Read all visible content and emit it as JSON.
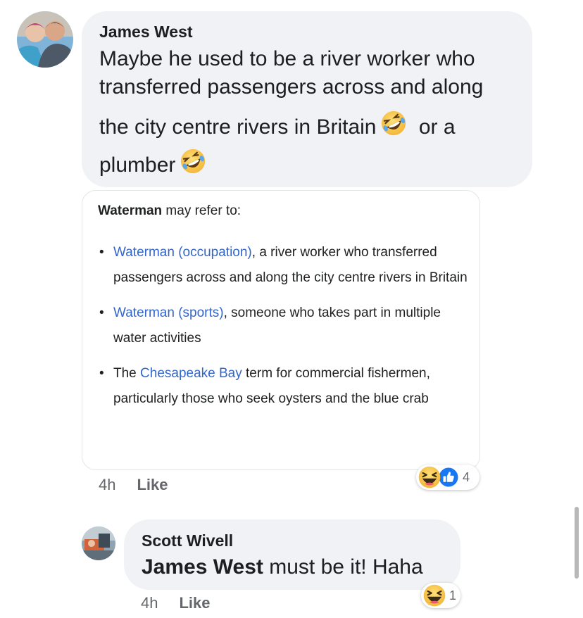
{
  "comment1": {
    "author": "James West",
    "text_line1": "Maybe he used to be a river worker who",
    "text_line2": "transferred passengers across and along",
    "text_line3": "the city centre rivers in Britain",
    "text_line3_tail": "or a",
    "text_line4": "plumber",
    "emoji": "rolling-on-floor-laughing-emoji",
    "time": "4h",
    "like_label": "Like",
    "reaction_count": "4",
    "reaction_icons": [
      "laughing-emoji",
      "thumbs-up-icon"
    ]
  },
  "card": {
    "intro_bold": "Waterman",
    "intro_rest": " may refer to:",
    "items": [
      {
        "link": "Waterman (occupation)",
        "text": ", a river worker who transferred passengers across and along the city centre rivers in Britain"
      },
      {
        "link": "Waterman (sports)",
        "text": ", someone who takes part in multiple water activities"
      },
      {
        "prefix": "The ",
        "link": "Chesapeake Bay",
        "text": " term for commercial fishermen, particularly those who seek oysters and the blue crab"
      }
    ]
  },
  "comment2": {
    "author": "Scott Wivell",
    "mention": "James West",
    "text": " must be it! Haha",
    "time": "4h",
    "like_label": "Like",
    "reaction_count": "1",
    "reaction_icons": [
      "laughing-emoji"
    ]
  },
  "colors": {
    "bubble": "#f0f2f5",
    "link": "#3366cc",
    "meta": "#65676b",
    "like_blue": "#1877f2",
    "emoji_yellow": "#f7c84a"
  }
}
